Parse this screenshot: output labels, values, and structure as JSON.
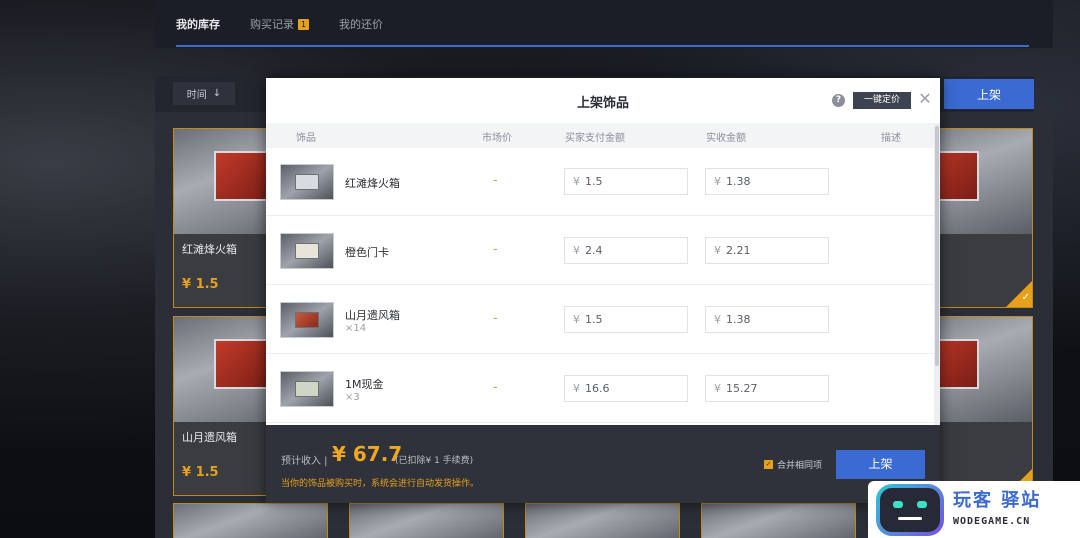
{
  "background": {
    "tabs": [
      {
        "label": "我的库存",
        "active": true
      },
      {
        "label": "购买记录",
        "badge": "1"
      },
      {
        "label": "我的还价"
      }
    ],
    "sort_label": "时间",
    "list_button": "上架",
    "cards": [
      {
        "name": "红滩烽火箱",
        "price": "¥ 1.5"
      },
      {
        "name": "山月遗风箱",
        "price": "¥ 1.5"
      }
    ]
  },
  "modal": {
    "title": "上架饰品",
    "oneclick_label": "一键定价",
    "columns": {
      "item": "饰品",
      "market": "市场价",
      "buyer_pay": "买家支付金额",
      "receive": "实收金额",
      "desc": "描述"
    },
    "currency": "¥",
    "rows": [
      {
        "name": "红滩烽火箱",
        "qty": "",
        "market": "-",
        "buyer_pay": "1.5",
        "receive": "1.38"
      },
      {
        "name": "橙色门卡",
        "qty": "",
        "market": "-",
        "buyer_pay": "2.4",
        "receive": "2.21"
      },
      {
        "name": "山月遗风箱",
        "qty": "×14",
        "market": "-",
        "buyer_pay": "1.5",
        "receive": "1.38"
      },
      {
        "name": "1M现金",
        "qty": "×3",
        "market": "-",
        "buyer_pay": "16.6",
        "receive": "15.27"
      }
    ],
    "footer": {
      "income_label": "预计收入 |",
      "income_value": "¥ 67.7",
      "fee_note": "(已扣除¥ 1 手续费)",
      "notice": "当你的饰品被购买时，系统会进行自动发货操作。",
      "merge_label": "合并相同项",
      "submit_label": "上架"
    }
  },
  "watermark": {
    "cn": "玩客 驿站",
    "en": "WODEGAME.CN"
  },
  "colors": {
    "accent_blue": "#3b6ad3",
    "price_gold": "#f0a81c",
    "footer_bg": "#2f323a"
  }
}
